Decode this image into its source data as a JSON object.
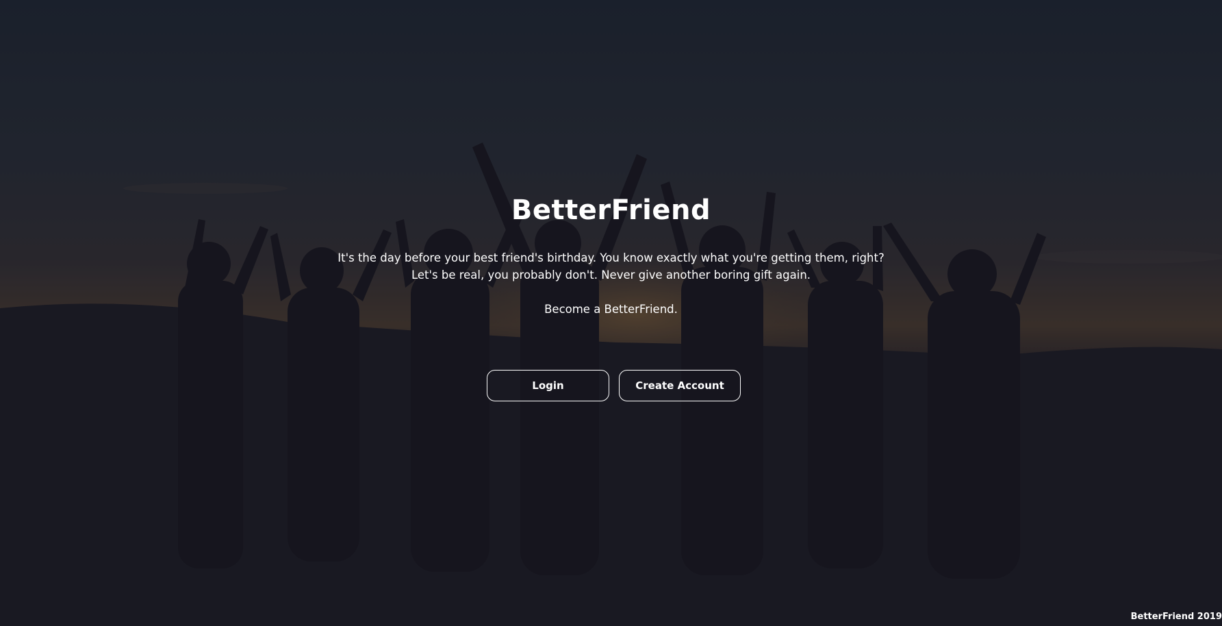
{
  "hero": {
    "title": "BetterFriend",
    "description": "It's the day before your best friend's birthday. You know exactly what you're getting them, right? Let's be real, you probably don't. Never give another boring gift again.",
    "tagline": "Become a BetterFriend."
  },
  "actions": {
    "login_label": "Login",
    "create_account_label": "Create Account"
  },
  "footer": {
    "copyright": "BetterFriend 2019"
  }
}
